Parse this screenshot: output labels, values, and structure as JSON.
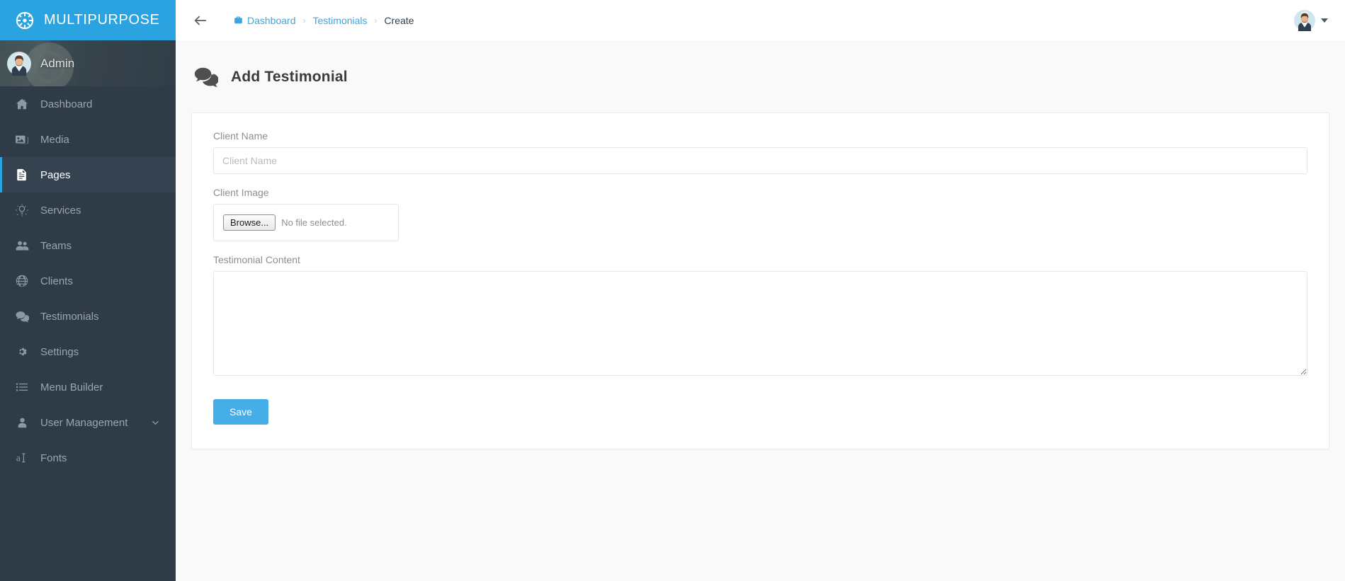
{
  "brand": {
    "title": "MULTIPURPOSE",
    "logo_icon": "ship-wheel-icon",
    "color": "#2ba3e0"
  },
  "user_panel": {
    "name": "Admin",
    "avatar_icon": "user-avatar"
  },
  "sidebar": {
    "items": [
      {
        "label": "Dashboard",
        "icon": "home-icon",
        "active": false,
        "has_caret": false
      },
      {
        "label": "Media",
        "icon": "image-icon",
        "active": false,
        "has_caret": false
      },
      {
        "label": "Pages",
        "icon": "file-text-icon",
        "active": true,
        "has_caret": false
      },
      {
        "label": "Services",
        "icon": "lightbulb-icon",
        "active": false,
        "has_caret": false
      },
      {
        "label": "Teams",
        "icon": "users-icon",
        "active": false,
        "has_caret": false
      },
      {
        "label": "Clients",
        "icon": "globe-icon",
        "active": false,
        "has_caret": false
      },
      {
        "label": "Testimonials",
        "icon": "comments-icon",
        "active": false,
        "has_caret": false
      },
      {
        "label": "Settings",
        "icon": "gear-icon",
        "active": false,
        "has_caret": false
      },
      {
        "label": "Menu Builder",
        "icon": "list-icon",
        "active": false,
        "has_caret": false
      },
      {
        "label": "User Management",
        "icon": "user-icon",
        "active": false,
        "has_caret": true
      },
      {
        "label": "Fonts",
        "icon": "font-icon",
        "active": false,
        "has_caret": false
      }
    ]
  },
  "topbar": {
    "back_icon": "arrow-left-icon",
    "breadcrumb": [
      {
        "label": "Dashboard",
        "icon": "briefcase-icon",
        "link": true
      },
      {
        "label": "Testimonials",
        "icon": "",
        "link": true
      },
      {
        "label": "Create",
        "icon": "",
        "link": false
      }
    ],
    "separator": "›",
    "avatar_icon": "user-avatar",
    "caret_icon": "caret-down-icon"
  },
  "page": {
    "title": "Add Testimonial",
    "title_icon": "comments-icon"
  },
  "form": {
    "client_name": {
      "label": "Client Name",
      "placeholder": "Client Name",
      "value": ""
    },
    "client_image": {
      "label": "Client Image",
      "browse_label": "Browse...",
      "status": "No file selected."
    },
    "testimonial_content": {
      "label": "Testimonial Content",
      "placeholder": "",
      "value": ""
    },
    "save_label": "Save",
    "save_color": "#45aee6"
  }
}
